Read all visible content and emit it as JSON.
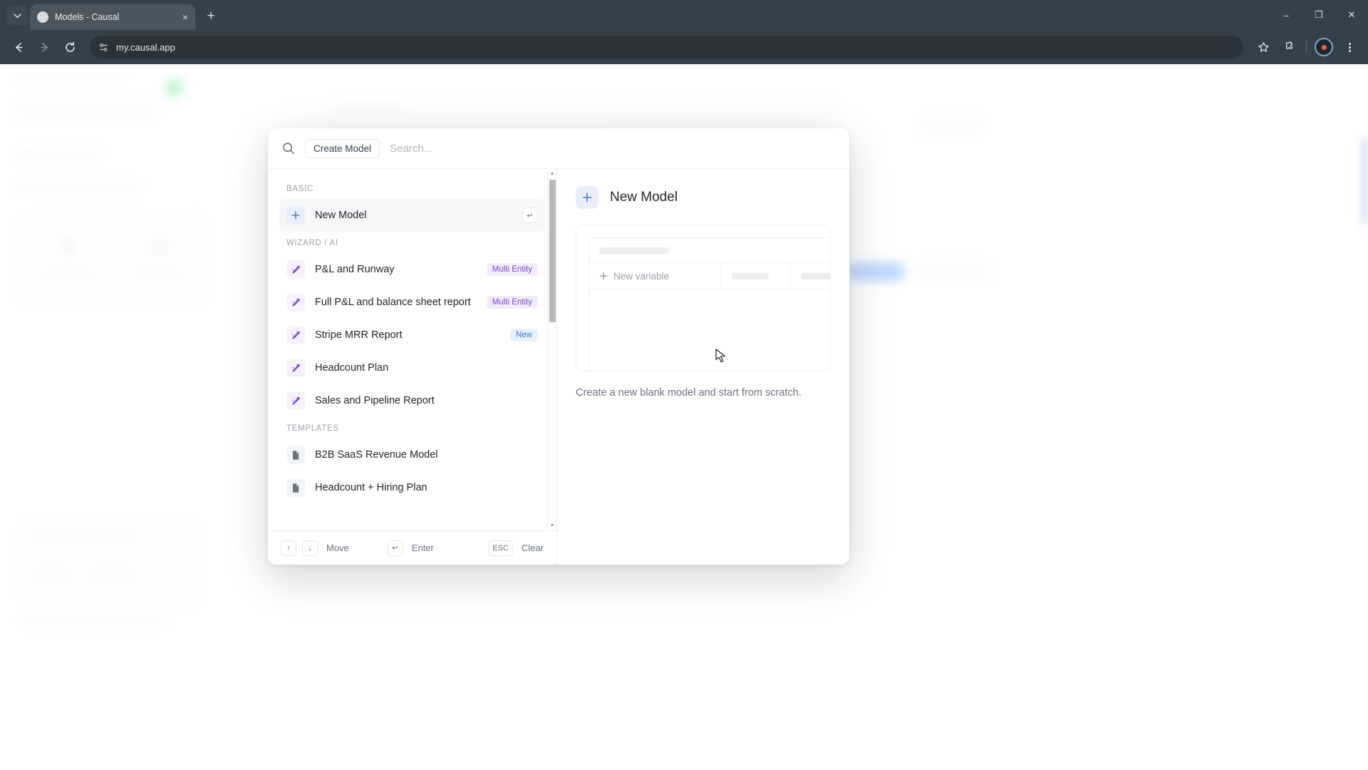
{
  "browser": {
    "tab": {
      "title": "Models - Causal",
      "favicon": "globe-icon",
      "close": "×"
    },
    "new_tab": "+",
    "tab_search": "⌄",
    "url": "my.causal.app",
    "nav": {
      "back": "←",
      "forward": "→",
      "reload": "↻"
    },
    "window": {
      "minimize": "–",
      "maximize": "❐",
      "close": "✕"
    }
  },
  "modal": {
    "search": {
      "chip_label": "Create Model",
      "placeholder": "Search...",
      "value": ""
    },
    "groups": [
      {
        "label": "BASIC",
        "items": [
          {
            "label": "New Model",
            "icon": "plus-icon",
            "icon_style": "plus",
            "selected": true,
            "key_hint": "↵"
          }
        ]
      },
      {
        "label": "WIZARD / AI",
        "items": [
          {
            "label": "P&L and Runway",
            "icon": "magic-wand-icon",
            "icon_style": "wand",
            "badge": "Multi Entity",
            "badge_style": "multi"
          },
          {
            "label": "Full P&L and balance sheet report",
            "icon": "magic-wand-icon",
            "icon_style": "wand",
            "badge": "Multi Entity",
            "badge_style": "multi"
          },
          {
            "label": "Stripe MRR Report",
            "icon": "magic-wand-icon",
            "icon_style": "wand",
            "badge": "New",
            "badge_style": "new"
          },
          {
            "label": "Headcount Plan",
            "icon": "magic-wand-icon",
            "icon_style": "wand"
          },
          {
            "label": "Sales and Pipeline Report",
            "icon": "magic-wand-icon",
            "icon_style": "wand"
          }
        ]
      },
      {
        "label": "TEMPLATES",
        "items": [
          {
            "label": "B2B SaaS Revenue Model",
            "icon": "document-icon",
            "icon_style": "doc"
          },
          {
            "label": "Headcount + Hiring Plan",
            "icon": "document-icon",
            "icon_style": "doc"
          }
        ]
      }
    ],
    "footer": {
      "up_key": "↑",
      "down_key": "↓",
      "move_label": "Move",
      "enter_key": "↵",
      "enter_label": "Enter",
      "esc_key": "ESC",
      "clear_label": "Clear"
    },
    "preview": {
      "title": "New Model",
      "icon": "plus-icon",
      "new_variable_label": "New variable",
      "new_variable_icon": "plus-icon",
      "description": "Create a new blank model and start from scratch."
    }
  },
  "colors": {
    "accent_blue": "#4d7fc4",
    "accent_purple": "#7c4fc9",
    "badge_multi_bg": "#f3ecfb",
    "badge_new_bg": "#e8f0fc",
    "chrome_bg": "#35414a"
  }
}
